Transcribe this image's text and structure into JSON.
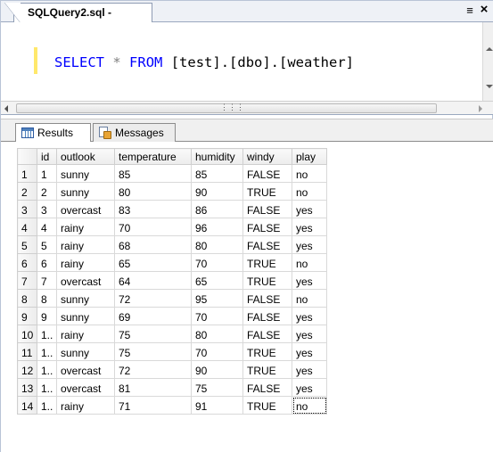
{
  "document_tab": {
    "label": "SQLQuery2.sql -",
    "menu_icon": "dropdown-icon",
    "close_icon": "close-icon"
  },
  "editor": {
    "keyword_select": "SELECT",
    "star": "*",
    "keyword_from": "FROM",
    "table_ref": "[test].[dbo].[weather]"
  },
  "results_tabs": [
    {
      "label": "Results",
      "icon": "grid-icon",
      "active": true
    },
    {
      "label": "Messages",
      "icon": "messages-icon",
      "active": false
    }
  ],
  "grid": {
    "columns": [
      "id",
      "outlook",
      "temperature",
      "humidity",
      "windy",
      "play"
    ],
    "rows": [
      {
        "rownum": "1",
        "cells": [
          "1",
          "sunny",
          "85",
          "85",
          "FALSE",
          "no"
        ]
      },
      {
        "rownum": "2",
        "cells": [
          "2",
          "sunny",
          "80",
          "90",
          "TRUE",
          "no"
        ]
      },
      {
        "rownum": "3",
        "cells": [
          "3",
          "overcast",
          "83",
          "86",
          "FALSE",
          "yes"
        ]
      },
      {
        "rownum": "4",
        "cells": [
          "4",
          "rainy",
          "70",
          "96",
          "FALSE",
          "yes"
        ]
      },
      {
        "rownum": "5",
        "cells": [
          "5",
          "rainy",
          "68",
          "80",
          "FALSE",
          "yes"
        ]
      },
      {
        "rownum": "6",
        "cells": [
          "6",
          "rainy",
          "65",
          "70",
          "TRUE",
          "no"
        ]
      },
      {
        "rownum": "7",
        "cells": [
          "7",
          "overcast",
          "64",
          "65",
          "TRUE",
          "yes"
        ]
      },
      {
        "rownum": "8",
        "cells": [
          "8",
          "sunny",
          "72",
          "95",
          "FALSE",
          "no"
        ]
      },
      {
        "rownum": "9",
        "cells": [
          "9",
          "sunny",
          "69",
          "70",
          "FALSE",
          "yes"
        ]
      },
      {
        "rownum": "10",
        "cells": [
          "1..",
          "rainy",
          "75",
          "80",
          "FALSE",
          "yes"
        ]
      },
      {
        "rownum": "11",
        "cells": [
          "1..",
          "sunny",
          "75",
          "70",
          "TRUE",
          "yes"
        ]
      },
      {
        "rownum": "12",
        "cells": [
          "1..",
          "overcast",
          "72",
          "90",
          "TRUE",
          "yes"
        ]
      },
      {
        "rownum": "13",
        "cells": [
          "1..",
          "overcast",
          "81",
          "75",
          "FALSE",
          "yes"
        ]
      },
      {
        "rownum": "14",
        "cells": [
          "1..",
          "rainy",
          "71",
          "91",
          "TRUE",
          "no"
        ]
      }
    ]
  },
  "colors": {
    "keyword": "#0000ff",
    "operator": "#808080",
    "change_marker": "#ffe86b"
  }
}
